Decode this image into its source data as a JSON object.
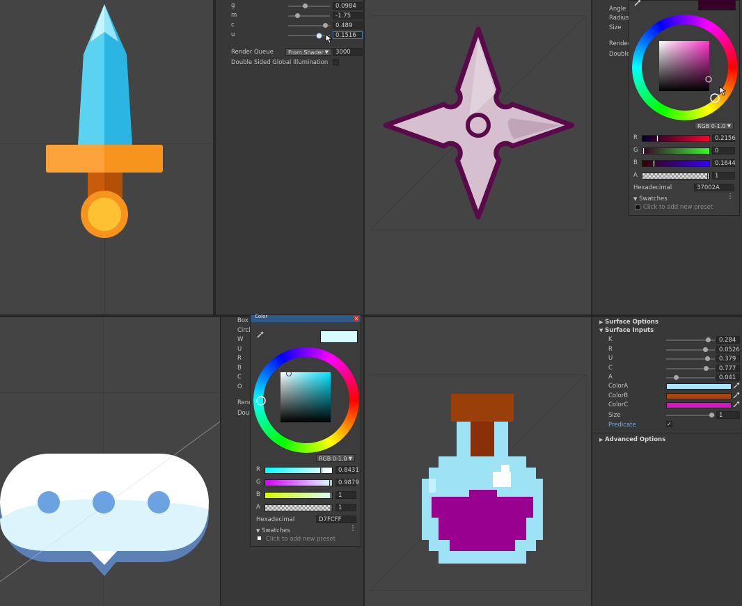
{
  "top_inspector": {
    "props": [
      {
        "label": "g",
        "value": "0.0984",
        "knob": 0.37
      },
      {
        "label": "m",
        "value": "-1.75",
        "knob": 0.18
      },
      {
        "label": "c",
        "value": "0.489",
        "knob": 0.9
      },
      {
        "label": "u",
        "value": "0.1516",
        "knob": 0.72
      }
    ],
    "render_queue_label": "Render Queue",
    "render_queue_mode": "From Shader",
    "render_queue_value": "3000",
    "double_sided_label": "Double Sided Global Illumination"
  },
  "color_picker_top": {
    "labels_behind": [
      "Angle",
      "Radius",
      "Size",
      "Render",
      "Double"
    ],
    "mode": "RGB 0-1.0",
    "channels": [
      {
        "name": "R",
        "value": "0.2156",
        "pos": 0.21
      },
      {
        "name": "G",
        "value": "0",
        "pos": 0.0
      },
      {
        "name": "B",
        "value": "0.1644",
        "pos": 0.16
      },
      {
        "name": "A",
        "value": "1",
        "pos": 0.99
      }
    ],
    "hex_label": "Hexadecimal",
    "hex_value": "37002A",
    "swatches_label": "Swatches",
    "swatches_hint": "Click to add new preset",
    "preview_color": "#37002a"
  },
  "color_picker_bottom": {
    "title": "Color",
    "labels_behind": [
      "Box C",
      "Circl",
      "W",
      "U",
      "R",
      "B",
      "C",
      "O",
      "Rend",
      "Doub"
    ],
    "mode": "RGB 0-1.0",
    "channels": [
      {
        "name": "R",
        "value": "0.8431",
        "pos": 0.84
      },
      {
        "name": "G",
        "value": "0.9879",
        "pos": 0.98
      },
      {
        "name": "B",
        "value": "1",
        "pos": 0.99
      },
      {
        "name": "A",
        "value": "1",
        "pos": 0.99
      }
    ],
    "hex_label": "Hexadecimal",
    "hex_value": "D7FCFF",
    "swatches_label": "Swatches",
    "swatches_hint": "Click to add new preset",
    "preview_color": "#d7fcff"
  },
  "surface_panel": {
    "surface_options": "Surface Options",
    "surface_inputs": "Surface Inputs",
    "props": [
      {
        "label": "K",
        "value": "0.284",
        "knob": 0.89
      },
      {
        "label": "R",
        "value": "0.0526",
        "knob": 0.83
      },
      {
        "label": "U",
        "value": "0.379",
        "knob": 0.87
      },
      {
        "label": "C",
        "value": "0.777",
        "knob": 0.85
      },
      {
        "label": "A",
        "value": "0.041",
        "knob": 0.17
      }
    ],
    "colors": [
      {
        "label": "ColorA",
        "color": "#a9e6fa"
      },
      {
        "label": "ColorB",
        "color": "#a9460d"
      },
      {
        "label": "ColorC",
        "color": "#d516c0"
      }
    ],
    "size_label": "Size",
    "size_value": "1",
    "size_knob": 0.97,
    "predicate_label": "Predicate",
    "predicate_checked": "✓",
    "advanced_options": "Advanced Options"
  },
  "icons": {
    "eyedropper": "eyedropper-icon",
    "kebab": "kebab-menu-icon",
    "close": "close-icon"
  },
  "colors": {
    "panel_bg": "#383838",
    "viewport_bg": "#444444",
    "focus_blue": "#3a79bb",
    "predicate_blue": "#7fa7e0"
  }
}
